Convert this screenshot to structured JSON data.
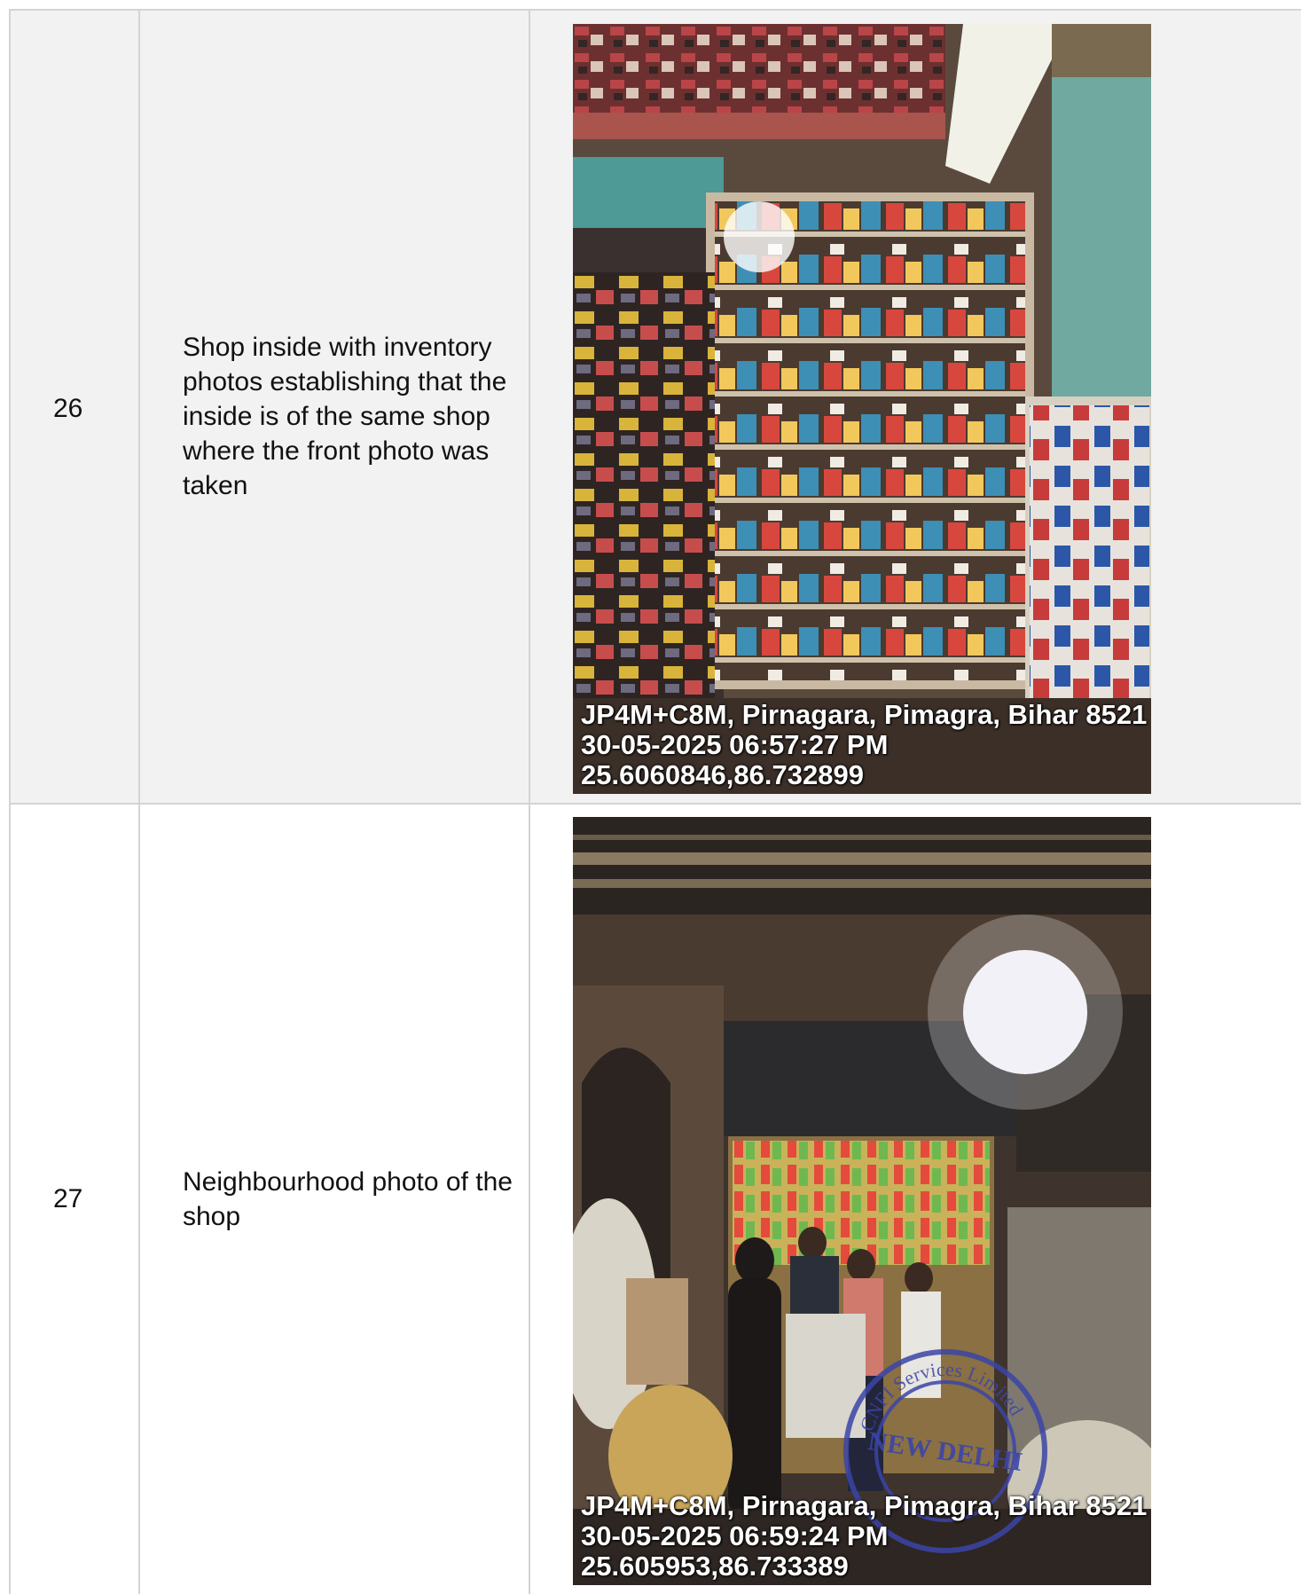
{
  "rows": [
    {
      "number": "26",
      "description": "Shop inside with inventory photos establishing that the inside is of the same shop where the front photo was taken",
      "photo": {
        "subject": "shop-interior-shelves",
        "overlay": {
          "address": "JP4M+C8M, Pirnagara, Pimagra, Bihar 8521",
          "datetime": "30-05-2025 06:57:27 PM",
          "coordinates": "25.6060846,86.732899"
        }
      }
    },
    {
      "number": "27",
      "description": "Neighbourhood photo of the shop",
      "photo": {
        "subject": "shop-neighbourhood-night",
        "overlay": {
          "address": "JP4M+C8M, Pirnagara, Pimagra, Bihar 8521",
          "datetime": "30-05-2025 06:59:24 PM",
          "coordinates": "25.605953,86.733389"
        },
        "seal": {
          "top_text": "CNFI Services Limited",
          "center_text": "NEW DELHI",
          "color": "#3b45a8"
        }
      }
    }
  ],
  "colors": {
    "border": "#d4d4d4",
    "row_shaded": "#f2f2f2",
    "row_plain": "#ffffff"
  }
}
